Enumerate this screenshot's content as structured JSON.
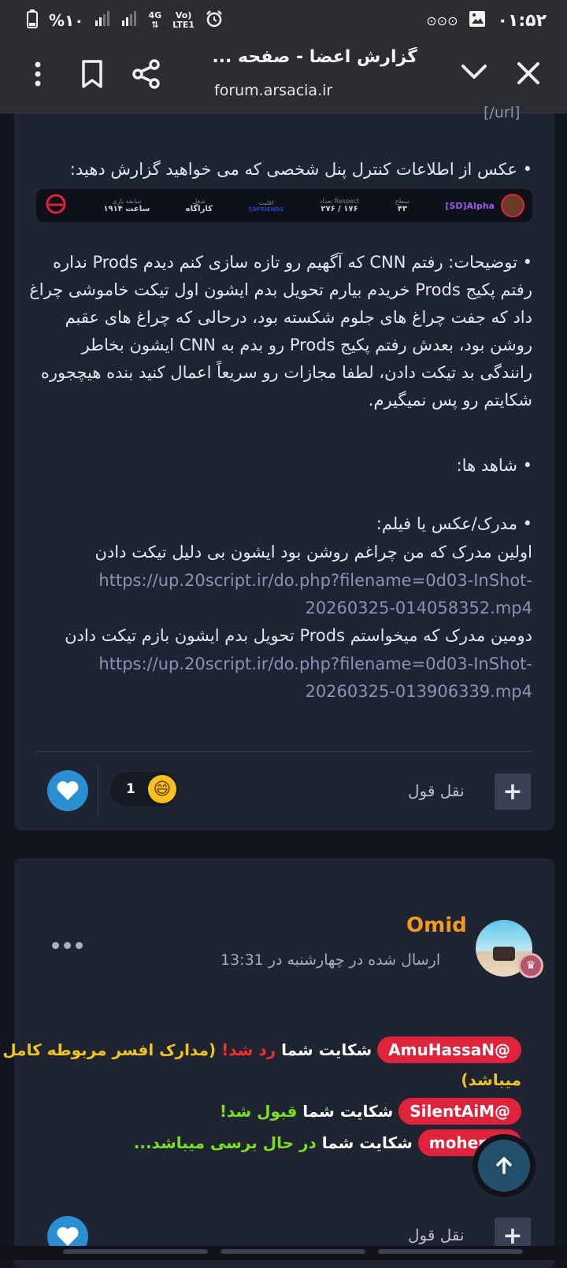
{
  "status_bar": {
    "time": "۰۱:۵۲",
    "battery": "%۱۰",
    "network": "4G",
    "lte": "LTE1",
    "volte": "Vo)",
    "right_icons": [
      "alarm-icon",
      "signal-icon",
      "signal-icon",
      "battery-icon"
    ],
    "left_icons": [
      "voicemail-icon",
      "image-icon"
    ]
  },
  "browser": {
    "title": "گزارش اعضا - صفحه ...",
    "url": "forum.arsacia.ir"
  },
  "post1": {
    "truncated_top": "[/url]",
    "screenshot_line": "• عکس از اطلاعات کنترل پنل شخصی که می خواهید گزارش دهید:",
    "panel": {
      "name": "[SD]Alpha",
      "cells": [
        {
          "k": "سطح",
          "v": "۴۳"
        },
        {
          "k": "تعداد Respect",
          "v": "۲۷۶ / ۱۷۶"
        },
        {
          "k": "اقلیت",
          "v": "SDFRIENDS"
        },
        {
          "k": "شغل",
          "v": "کاراگاه"
        },
        {
          "k": "سابقه بازی",
          "v": "۱۹۱۴ ساعت"
        }
      ]
    },
    "description": "• توضیحات: رفتم CNN که آگهیم رو تازه سازی کنم دیدم Prods نداره رفتم پکیج Prods خریدم بیارم تحویل بدم ایشون اول تیکت خاموشی چراغ داد که جفت چراغ های جلوم شکسته بود، درحالی که چراغ های عقبم روشن بود، بعدش رفتم پکیج Prods رو بدم به CNN ایشون بخاطر رانندگی بد تیکت دادن، لطفا مجازات رو سریعاً اعمال کنید بنده هیچجوره شکایتم رو پس نمیگیرم.",
    "witnesses": "• شاهد ها:",
    "evidence_label": "• مدرک/عکس یا فیلم:",
    "evidence1_text": "اولین مدرک که من چراغم روشن بود ایشون بی دلیل تیکت دادن",
    "evidence1_link_a": "https://up.20script.ir/do.php?filename=0d03-InShot-",
    "evidence1_link_b": "20260325-014058352.mp4",
    "evidence2_text": "دومین مدرک که میخواستم Prods تحویل بدم ایشون بازم تیکت دادن",
    "evidence2_link_a": "https://up.20script.ir/do.php?filename=0d03-InShot-",
    "evidence2_link_b": "20260325-013906339.mp4",
    "quote_label": "نقل قول",
    "reaction_count": "1"
  },
  "post2": {
    "author": "Omid",
    "meta": "ارسال شده در چهارشنبه در 13:31",
    "lines": [
      {
        "mention": "AmuHassaN@",
        "pre": "شکایت شما",
        "status": "رد شد!",
        "post": "(مدارک افسر مربوطه کامل"
      },
      {
        "mention": "SilentAiM@",
        "pre": "شکایت شما",
        "status": "قبول شد!"
      },
      {
        "mention": "mohem@",
        "pre": "شکایت شما",
        "status": "در حال برسی میباشد..."
      }
    ],
    "line1_cont": "میباشد)",
    "quote_label": "نقل قول"
  },
  "colors": {
    "accent_author": "#f59a1b",
    "rejected": "#ff2a2a",
    "accepted": "#7be01e",
    "pending_text": "#f0c419",
    "mention_bg": "#e0223b"
  }
}
